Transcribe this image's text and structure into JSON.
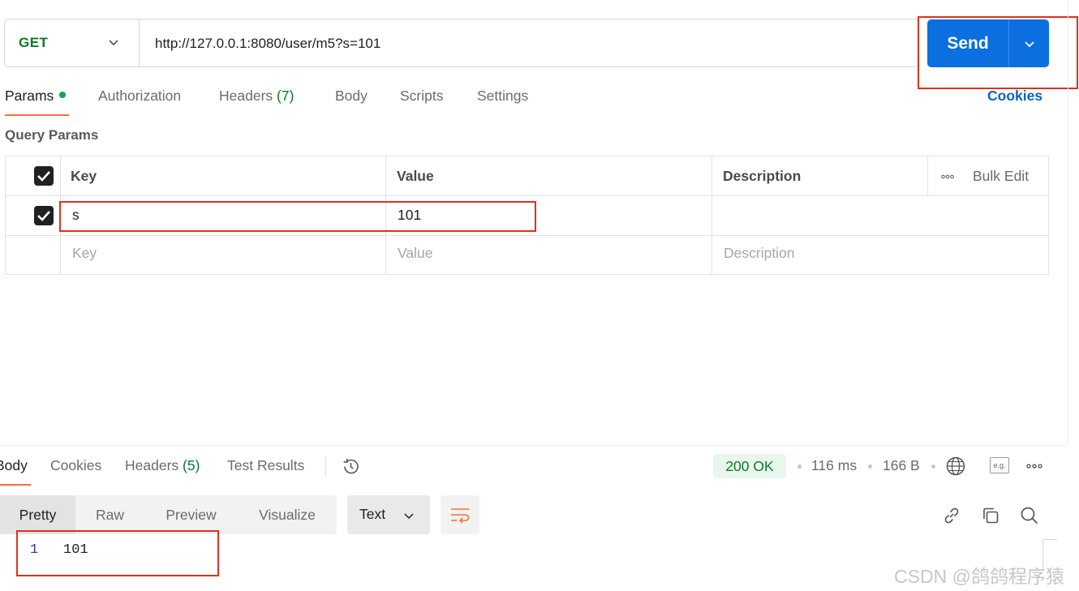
{
  "request": {
    "method": "GET",
    "url": "http://127.0.0.1:8080/user/m5?s=101",
    "send_label": "Send"
  },
  "request_tabs": {
    "params": "Params",
    "authorization": "Authorization",
    "headers": "Headers",
    "headers_count": "(7)",
    "body": "Body",
    "scripts": "Scripts",
    "settings": "Settings",
    "cookies": "Cookies"
  },
  "query_params": {
    "title": "Query Params",
    "columns": {
      "key": "Key",
      "value": "Value",
      "description": "Description",
      "bulk_edit": "Bulk Edit"
    },
    "rows": [
      {
        "key": "s",
        "value": "101",
        "description": "",
        "checked": true
      }
    ],
    "placeholders": {
      "key": "Key",
      "value": "Value",
      "description": "Description"
    }
  },
  "response": {
    "tabs": {
      "body": "Body",
      "cookies": "Cookies",
      "headers": "Headers",
      "headers_count": "(5)",
      "test_results": "Test Results"
    },
    "status": "200 OK",
    "time": "116 ms",
    "size": "166 B",
    "example_label": "e.g.",
    "view_modes": [
      "Pretty",
      "Raw",
      "Preview",
      "Visualize"
    ],
    "format": "Text",
    "lines": [
      {
        "no": "1",
        "text": "101"
      }
    ]
  },
  "watermark": "CSDN @鸽鸽程序猿",
  "colors": {
    "primary_blue": "#0b6fe0",
    "accent_orange": "#ff6c37",
    "success_green": "#0a7a2a",
    "annotation_red": "#e0301e"
  },
  "icons": [
    "chevron-down-icon",
    "more-icon",
    "history-icon",
    "globe-icon",
    "example-icon",
    "wrap-icon",
    "link-icon",
    "copy-icon",
    "search-icon"
  ]
}
